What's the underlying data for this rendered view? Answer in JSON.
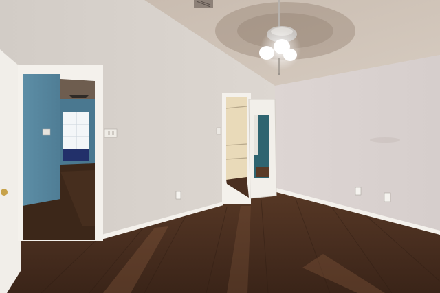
{
  "scene": {
    "subject": "empty-bedroom-interior",
    "elements": [
      "vaulted-ceiling",
      "ceiling-fan",
      "left-wall",
      "right-wall",
      "open-doorway-hallway",
      "walk-in-closet-doorway",
      "mirrored-closet-door",
      "hardwood-floor",
      "baseboards",
      "electrical-outlets",
      "light-switch"
    ]
  },
  "colors": {
    "wall_left": "#d8d2cc",
    "wall_right": "#dcd4d2",
    "ceiling": "#cfc3b8",
    "floor_dark": "#3f281b",
    "floor_mid": "#5a3a26",
    "floor_light": "#7a5238",
    "hallway_wall": "#5f8fa6",
    "closet_interior": "#e8d9b8",
    "trim": "#f4f1ec",
    "fan_blade": "#8a7563"
  }
}
